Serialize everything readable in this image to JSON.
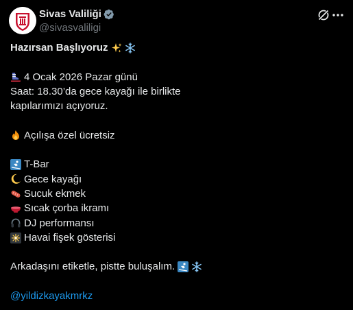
{
  "header": {
    "display_name": "Sivas Valiliği",
    "handle": "@sivasvaliligi",
    "avatar_icon": "sivas-valiligi-logo",
    "verified_icon": "verified-badge-icon",
    "verified_color": "#829aab",
    "grok_icon": "grok-icon",
    "more_icon": "more-icon"
  },
  "tweet": {
    "title": "Hazırsan Başlıyoruz",
    "title_emojis": [
      "sparkles-emoji",
      "snowflake-emoji"
    ],
    "date_emoji": "ski-emoji",
    "date_line": "4 Ocak 2026 Pazar günü",
    "time_line": "Saat: 18.30’da gece kayağı ile birlikte",
    "doors_line": "kapılarımızı açıyoruz.",
    "fire_emoji": "fire-emoji",
    "free_line": "Açılışa özel ücretsiz",
    "items": [
      {
        "emoji": "skier-emoji",
        "label": "T-Bar"
      },
      {
        "emoji": "crescent-moon-emoji",
        "label": "Gece kayağı"
      },
      {
        "emoji": "sausage-emoji",
        "label": "Sucuk ekmek"
      },
      {
        "emoji": "soup-bowl-emoji",
        "label": "Sıcak çorba ikramı"
      },
      {
        "emoji": "headphones-emoji",
        "label": "DJ performansı"
      },
      {
        "emoji": "fireworks-emoji",
        "label": "Havai fişek gösterisi"
      }
    ],
    "closing_line": "Arkadaşını etiketle, pistte buluşalım.",
    "closing_emojis": [
      "skier-emoji",
      "snowflake-emoji"
    ],
    "mention": "@yildizkayakmrkz",
    "link_color": "#1d9bf0"
  }
}
